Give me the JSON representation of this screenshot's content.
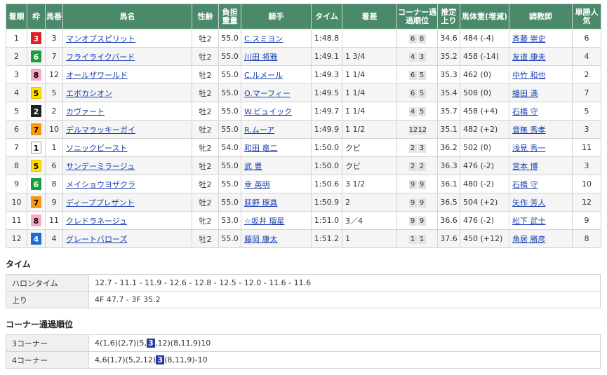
{
  "headers": [
    "着順",
    "枠",
    "馬番",
    "馬名",
    "性齢",
    "負担重量",
    "騎手",
    "タイム",
    "着差",
    "コーナー通過順位",
    "推定上り",
    "馬体重(増減)",
    "調教師",
    "単勝人気"
  ],
  "rows": [
    {
      "rank": "1",
      "waku": "3",
      "num": "3",
      "horse": "マンオブスピリット",
      "sex": "牡2",
      "weight": "55.0",
      "jockey": "C.スミヨン",
      "time": "1:48.8",
      "margin": "",
      "c1": "6",
      "c2": "8",
      "last": "34.6",
      "body": "484 (-4)",
      "trainer": "斉藤 崇史",
      "pop": "6"
    },
    {
      "rank": "2",
      "waku": "6",
      "num": "7",
      "horse": "フライライクバード",
      "sex": "牡2",
      "weight": "55.0",
      "jockey": "川田 将雅",
      "time": "1:49.1",
      "margin": "1 3/4",
      "c1": "4",
      "c2": "3",
      "last": "35.2",
      "body": "458 (-14)",
      "trainer": "友道 康夫",
      "pop": "4"
    },
    {
      "rank": "3",
      "waku": "8",
      "num": "12",
      "horse": "オールザワールド",
      "sex": "牡2",
      "weight": "55.0",
      "jockey": "C.ルメール",
      "time": "1:49.3",
      "margin": "1 1/4",
      "c1": "6",
      "c2": "5",
      "last": "35.3",
      "body": "462 (0)",
      "trainer": "中竹 和也",
      "pop": "2"
    },
    {
      "rank": "4",
      "waku": "5",
      "num": "5",
      "horse": "エボカシオン",
      "sex": "牡2",
      "weight": "55.0",
      "jockey": "O.マーフィー",
      "time": "1:49.5",
      "margin": "1 1/4",
      "c1": "6",
      "c2": "5",
      "last": "35.4",
      "body": "508 (0)",
      "trainer": "播田 満",
      "pop": "7"
    },
    {
      "rank": "5",
      "waku": "2",
      "num": "2",
      "horse": "カヴァート",
      "sex": "牡2",
      "weight": "55.0",
      "jockey": "W.ビュイック",
      "time": "1:49.7",
      "margin": "1 1/4",
      "c1": "4",
      "c2": "5",
      "last": "35.7",
      "body": "458 (+4)",
      "trainer": "石橋 守",
      "pop": "5"
    },
    {
      "rank": "6",
      "waku": "7",
      "num": "10",
      "horse": "デルマラッキーガイ",
      "sex": "牡2",
      "weight": "55.0",
      "jockey": "R.ムーア",
      "time": "1:49.9",
      "margin": "1 1/2",
      "c1": "12",
      "c2": "12",
      "last": "35.1",
      "body": "482 (+2)",
      "trainer": "音無 秀孝",
      "pop": "3"
    },
    {
      "rank": "7",
      "waku": "1",
      "num": "1",
      "horse": "ソニックビースト",
      "sex": "牝2",
      "weight": "54.0",
      "jockey": "和田 竜二",
      "time": "1:50.0",
      "margin": "クビ",
      "c1": "2",
      "c2": "3",
      "last": "36.2",
      "body": "502 (0)",
      "trainer": "浅見 秀一",
      "pop": "11"
    },
    {
      "rank": "8",
      "waku": "5",
      "num": "6",
      "horse": "サンデーミラージュ",
      "sex": "牡2",
      "weight": "55.0",
      "jockey": "武 豊",
      "time": "1:50.0",
      "margin": "クビ",
      "c1": "2",
      "c2": "2",
      "last": "36.3",
      "body": "476 (-2)",
      "trainer": "宮本 博",
      "pop": "3"
    },
    {
      "rank": "9",
      "waku": "6",
      "num": "8",
      "horse": "メイショウヨザクラ",
      "sex": "牡2",
      "weight": "55.0",
      "jockey": "幸 英明",
      "time": "1:50.6",
      "margin": "3 1/2",
      "c1": "9",
      "c2": "9",
      "last": "36.1",
      "body": "480 (-2)",
      "trainer": "石橋 守",
      "pop": "10"
    },
    {
      "rank": "10",
      "waku": "7",
      "num": "9",
      "horse": "ディーププレザント",
      "sex": "牡2",
      "weight": "55.0",
      "jockey": "荻野 琢真",
      "time": "1:50.9",
      "margin": "2",
      "c1": "9",
      "c2": "9",
      "last": "36.5",
      "body": "504 (+2)",
      "trainer": "矢作 芳人",
      "pop": "12"
    },
    {
      "rank": "11",
      "waku": "8",
      "num": "11",
      "horse": "クレドラネージュ",
      "sex": "牝2",
      "weight": "53.0",
      "jockey": "☆坂井 瑠星",
      "time": "1:51.0",
      "margin": "3／4",
      "c1": "9",
      "c2": "9",
      "last": "36.6",
      "body": "476 (-2)",
      "trainer": "松下 武士",
      "pop": "9"
    },
    {
      "rank": "12",
      "waku": "4",
      "num": "4",
      "horse": "グレートバローズ",
      "sex": "牡2",
      "weight": "55.0",
      "jockey": "藤岡 康太",
      "time": "1:51.2",
      "margin": "1",
      "c1": "1",
      "c2": "1",
      "last": "37.6",
      "body": "450 (+12)",
      "trainer": "角居 勝彦",
      "pop": "8"
    }
  ],
  "time_section": {
    "title": "タイム",
    "halon_label": "ハロンタイム",
    "halon_value": "12.7 - 11.1 - 11.9 - 12.6 - 12.8 - 12.5 - 12.0 - 11.6 - 11.6",
    "agari_label": "上り",
    "agari_value": "4F 47.7 - 3F 35.2"
  },
  "corner_section": {
    "title": "コーナー通過順位",
    "c3_label": "3コーナー",
    "c3_pre": "4(1,6)(2,7)(5,",
    "c3_hl": "3",
    "c3_post": ",12)(8,11,9)10",
    "c4_label": "4コーナー",
    "c4_pre": "4,6(1,7)(5,2,12)",
    "c4_hl": "3",
    "c4_post": "(8,11,9)-10"
  }
}
